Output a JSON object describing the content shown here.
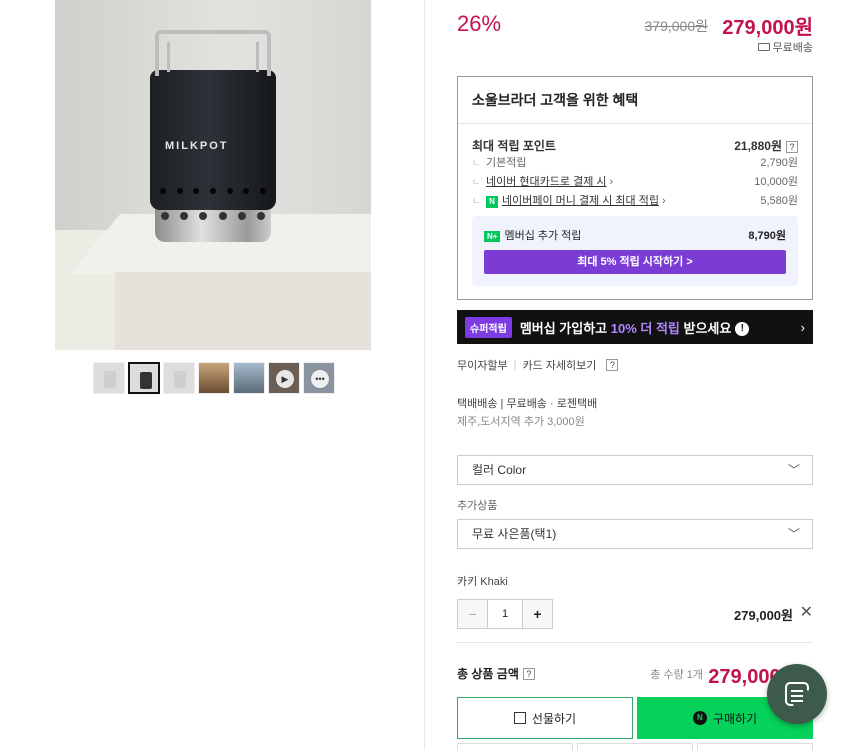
{
  "gallery": {
    "brand_text": "MILKPOT",
    "thumbnails": [
      "thumb-1",
      "thumb-2",
      "thumb-3",
      "thumb-4",
      "thumb-5",
      "video-thumb",
      "review-thumb"
    ]
  },
  "price": {
    "discount": "26%",
    "original": "379,000원",
    "sale": "279,000원",
    "shipping": "무료배송"
  },
  "benefit": {
    "title": "소울브라더 고객을 위한 혜택",
    "max_points_label": "최대 적립 포인트",
    "max_points_value": "21,880원",
    "rows": [
      {
        "label": "기본적립",
        "value": "2,790원"
      },
      {
        "label": "네이버 현대카드로 결제 시",
        "value": "10,000원"
      },
      {
        "label": "네이버페이 머니 결제 시 최대 적립",
        "value": "5,580원"
      }
    ],
    "membership_label": "멤버십 추가 적립",
    "membership_value": "8,790원",
    "membership_button": "최대 5% 적립 시작하기 >"
  },
  "super_banner": {
    "badge": "슈퍼적립",
    "text_pre": "멤버십 가입하고 ",
    "text_highlight": "10% 더 적립",
    "text_post": " 받으세요"
  },
  "installment": {
    "label": "무이자할부",
    "card_details": "카드 자세히보기"
  },
  "delivery": {
    "line": "택배배송 | 무료배송 · 로젠택배",
    "extra": "제주,도서지역 추가 3,000원"
  },
  "options": {
    "color_select": "컬러 Color",
    "addon_label": "추가상품",
    "addon_select": "무료 사은품(택1)"
  },
  "selected_item": {
    "name": "카키 Khaki",
    "quantity": "1",
    "price": "279,000원"
  },
  "total": {
    "label": "총 상품 금액",
    "qty": "총 수량 1개",
    "price": "279,000원"
  },
  "buttons": {
    "gift": "선물하기",
    "buy": "구매하기"
  },
  "colors": {
    "price_red": "#c4124a",
    "naver_green": "#06d15a",
    "member_purple": "#7b3cd6"
  }
}
